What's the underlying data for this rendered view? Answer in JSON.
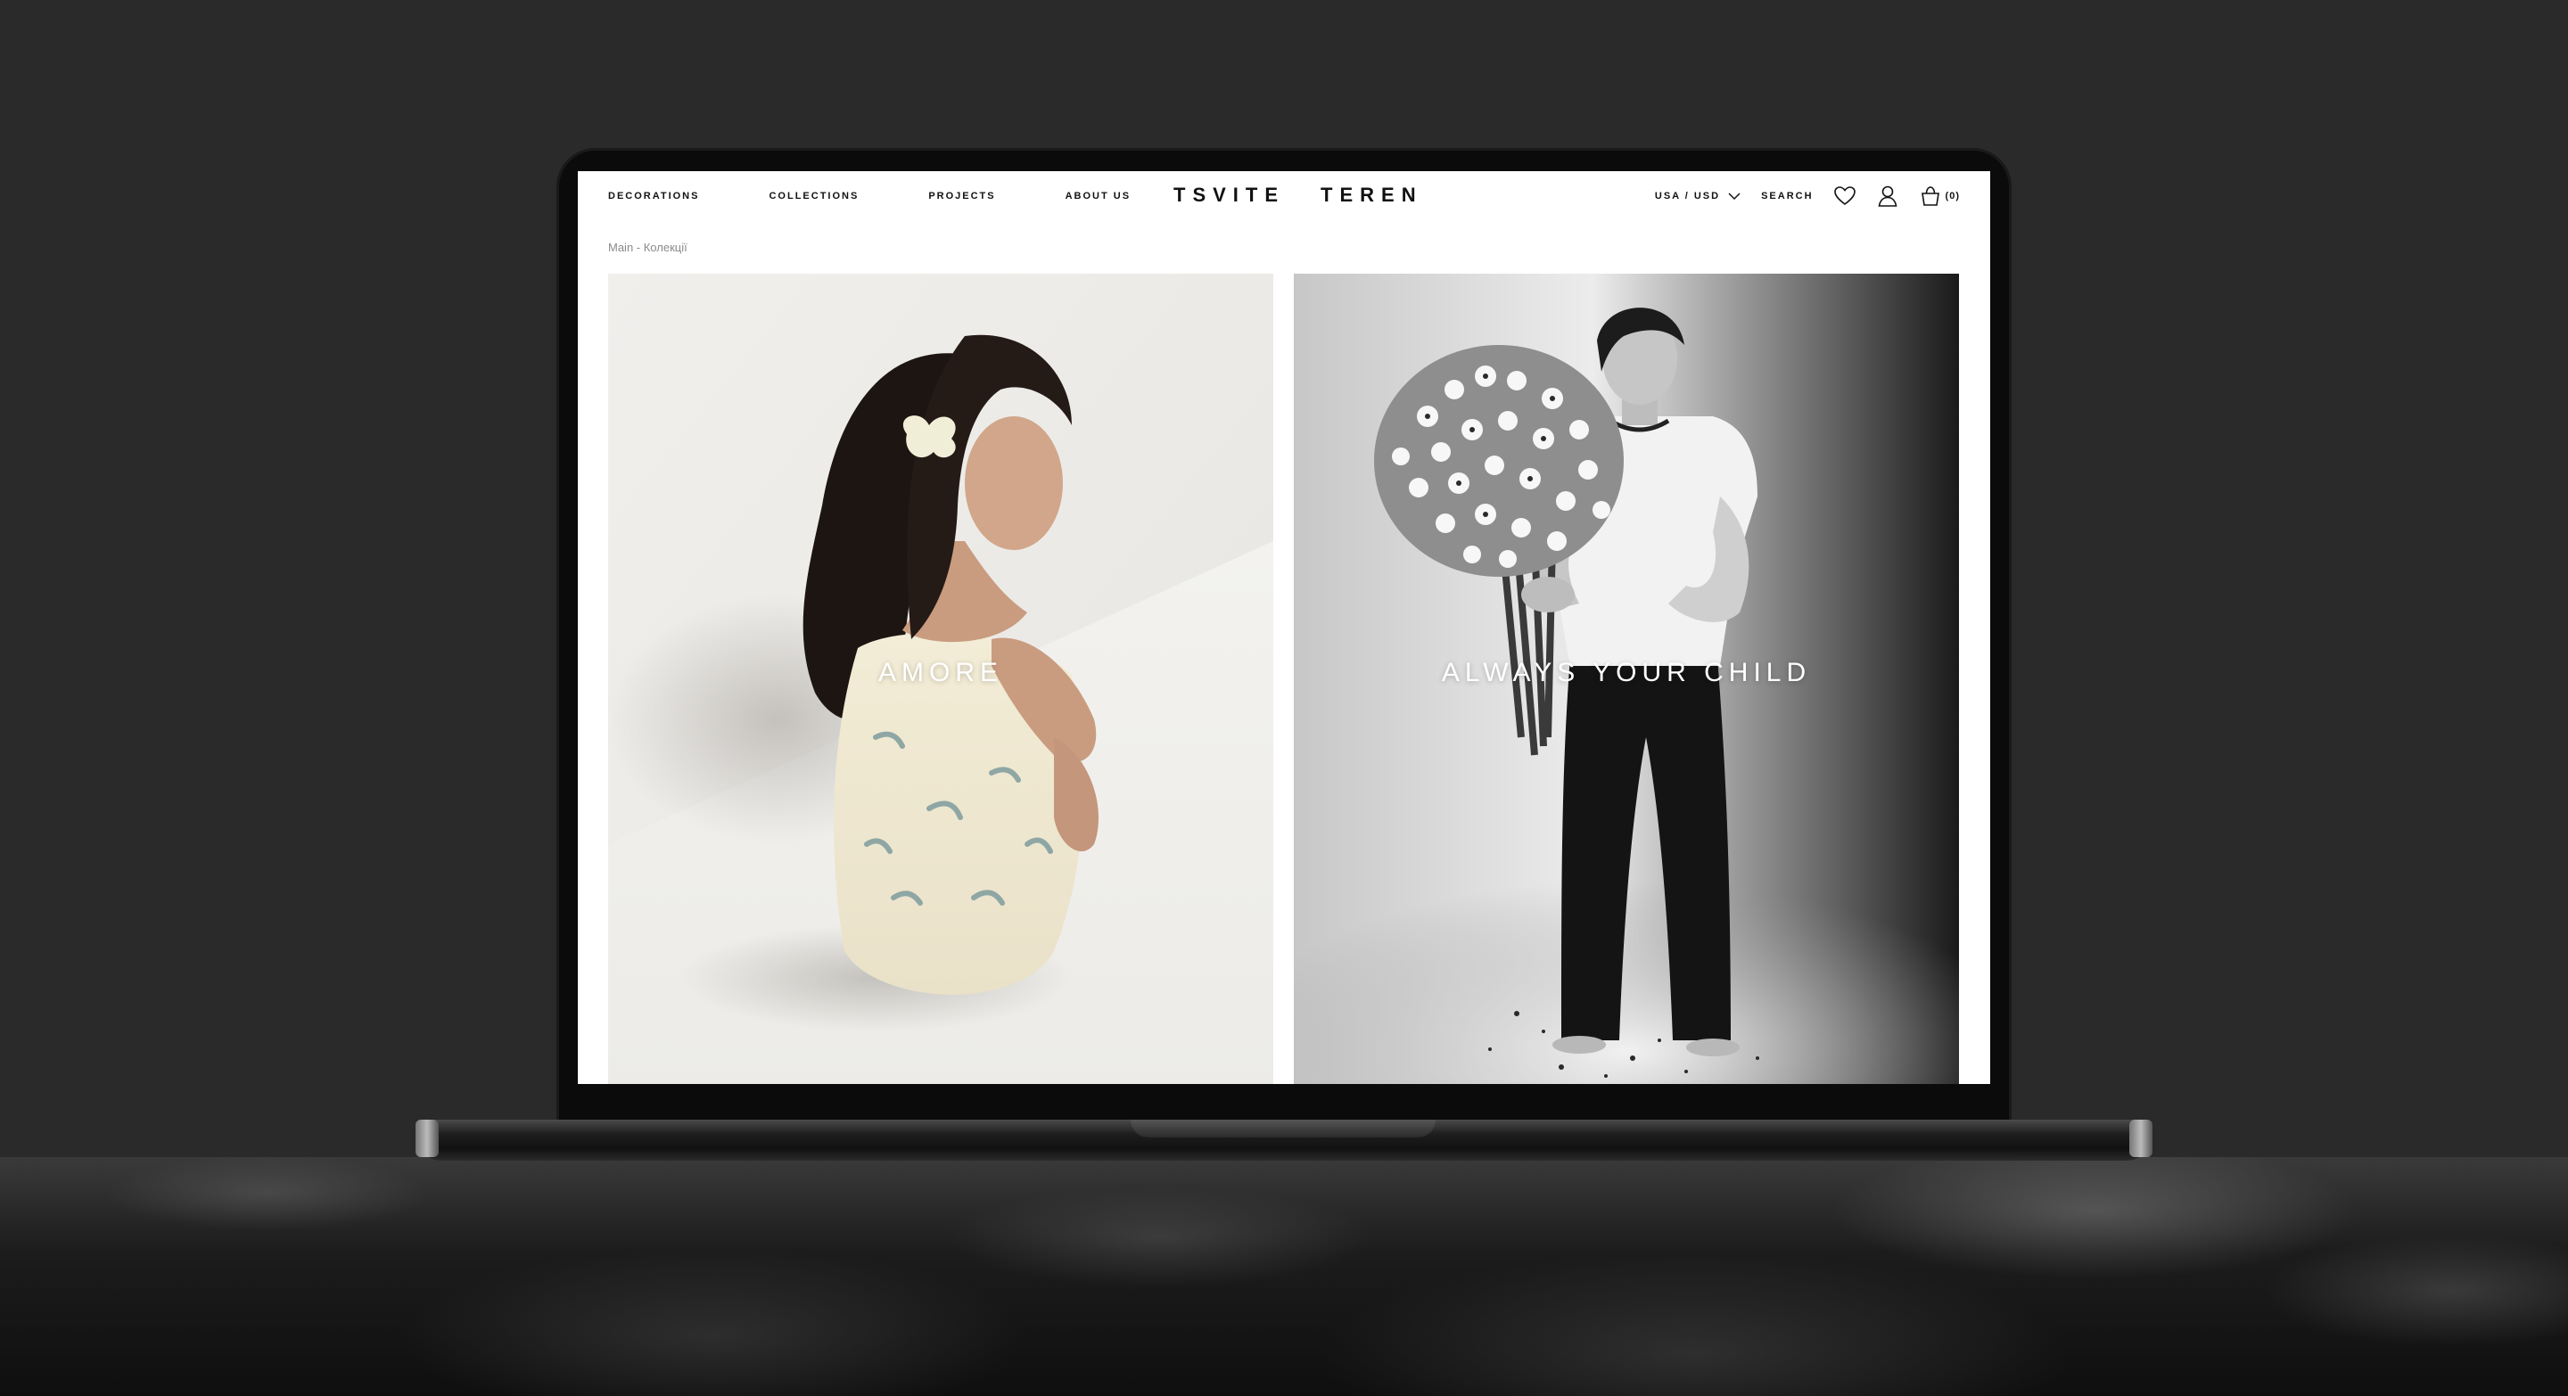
{
  "nav": {
    "links": [
      "DECORATIONS",
      "COLLECTIONS",
      "PROJECTS",
      "ABOUT US"
    ],
    "logo_words": [
      "TSVITE",
      "TEREN"
    ],
    "currency": "USA / USD",
    "search": "SEARCH",
    "cart_count": "(0)"
  },
  "breadcrumb": "Main - Колекції",
  "collections": [
    {
      "title": "AMORE"
    },
    {
      "title": "ALWAYS YOUR CHILD"
    }
  ],
  "icons": {
    "wishlist": "heart-icon",
    "account": "user-icon",
    "cart": "bag-icon",
    "dropdown": "chevron-down-icon"
  },
  "colors": {
    "background": "#2a2a2a",
    "screen": "#ffffff",
    "text": "#111111",
    "breadcrumb": "#8a8a8a"
  }
}
